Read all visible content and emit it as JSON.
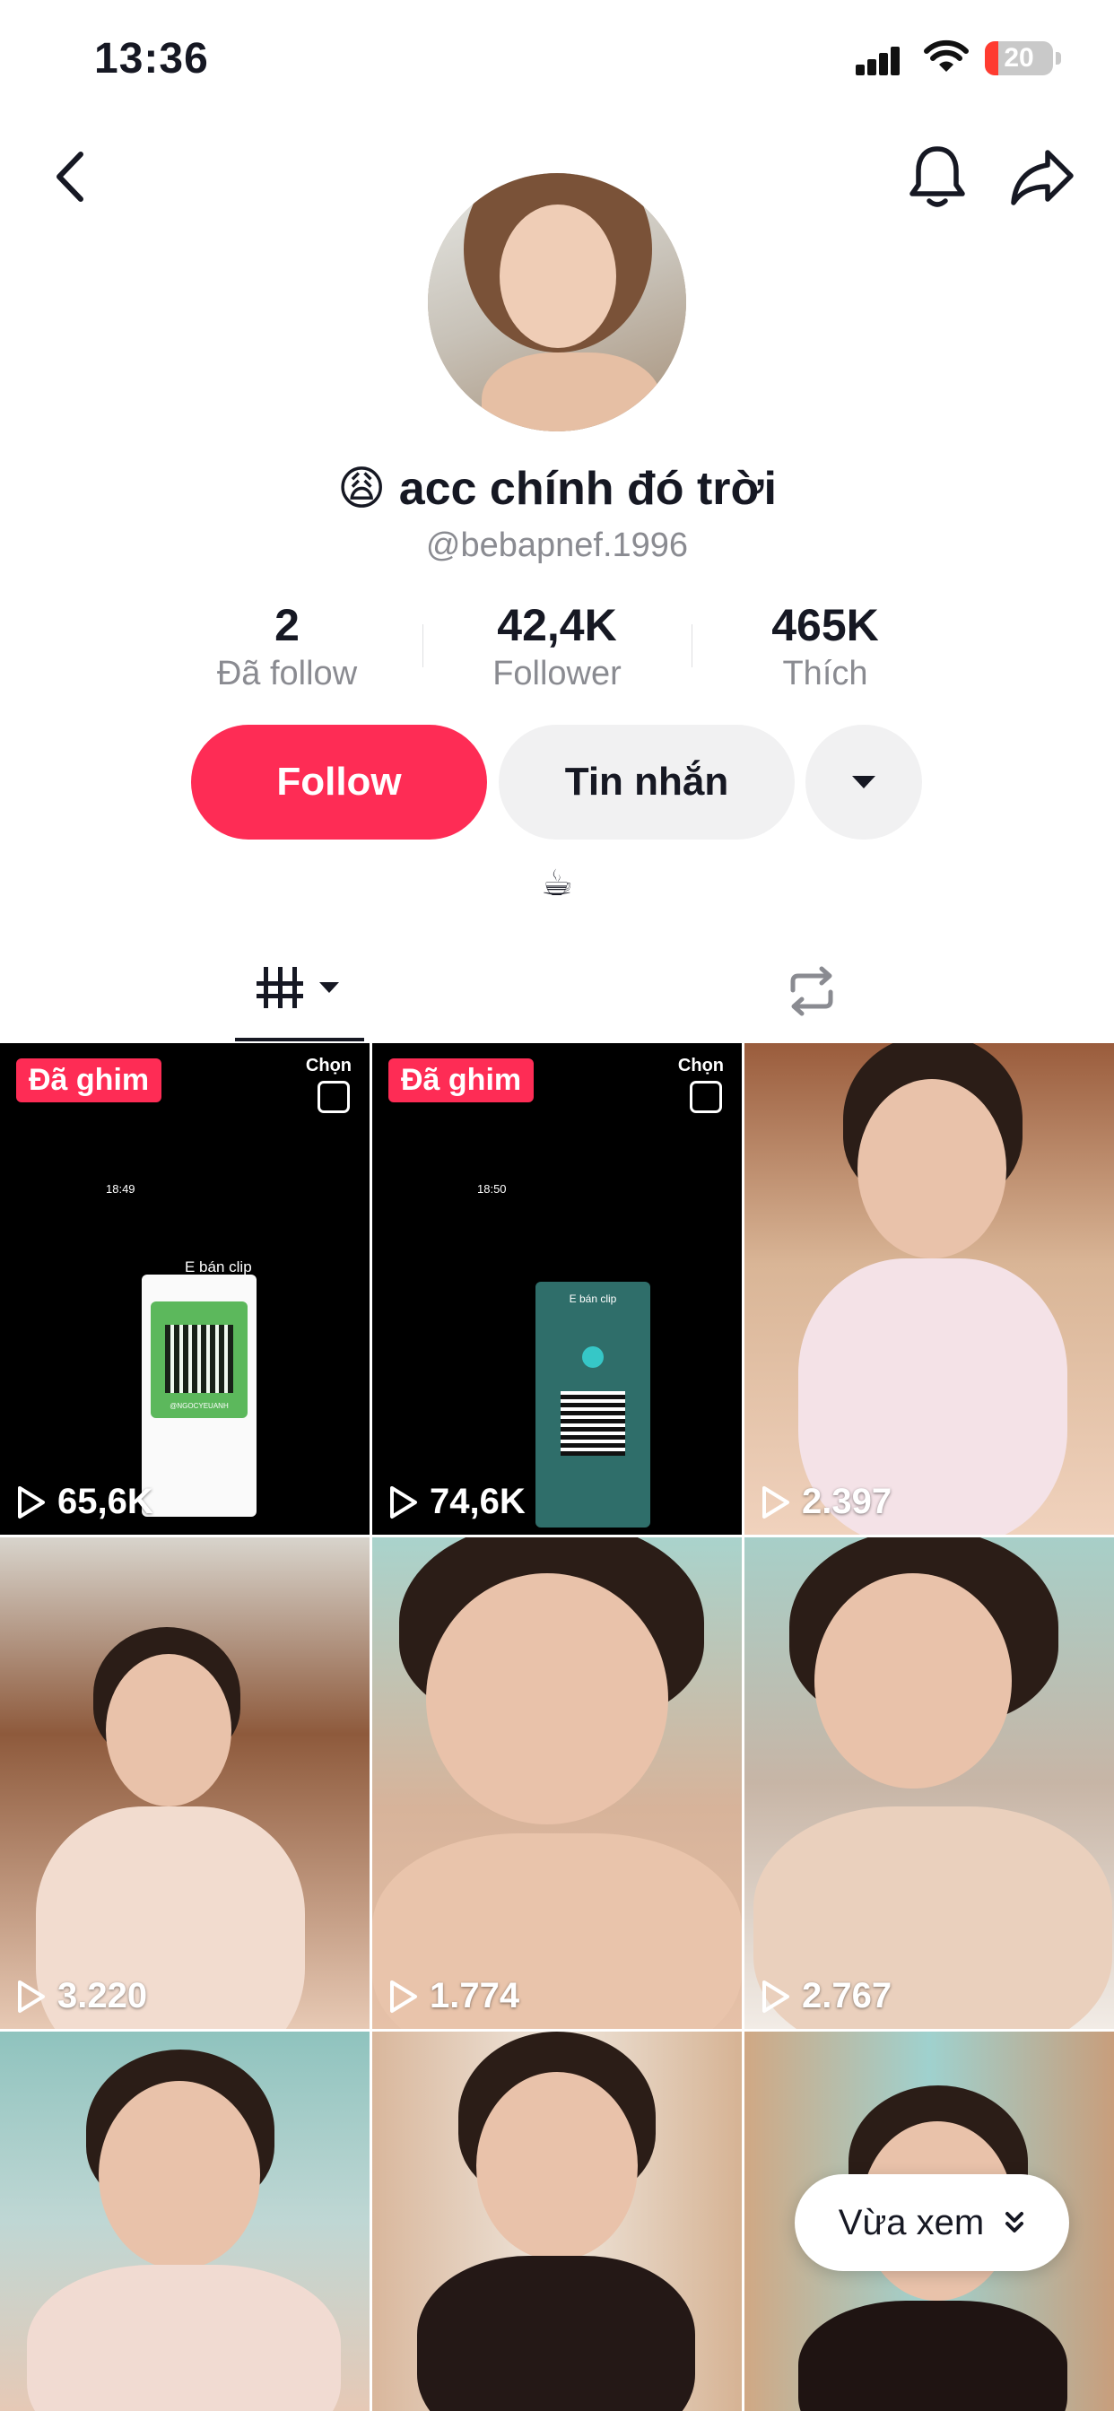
{
  "status_bar": {
    "time": "13:36",
    "battery": "20",
    "battery_fraction": 0.2
  },
  "profile": {
    "display_name": "😩 acc chính đó trời",
    "username": "@bebapnef.1996",
    "stats": [
      {
        "value": "2",
        "label": "Đã follow"
      },
      {
        "value": "42,4K",
        "label": "Follower"
      },
      {
        "value": "465K",
        "label": "Thích"
      }
    ],
    "follow_label": "Follow",
    "message_label": "Tin nhắn",
    "bio": "☕"
  },
  "colors": {
    "accent": "#fe2c55",
    "secondary_button": "#f1f1f2",
    "muted_text": "#8a8b91"
  },
  "videos": [
    {
      "views": "65,6K",
      "pinned_label": "Đã ghim",
      "select_label": "Chọn",
      "screen_time": "18:49",
      "screen_title": "E bán clip",
      "screen_user": "@NGOCYEUANH"
    },
    {
      "views": "74,6K",
      "pinned_label": "Đã ghim",
      "select_label": "Chọn",
      "screen_time": "18:50",
      "screen_title": "E bán clip"
    },
    {
      "views": "2.397"
    },
    {
      "views": "3.220"
    },
    {
      "views": "1.774"
    },
    {
      "views": "2.767"
    },
    {
      "views": ""
    },
    {
      "views": ""
    },
    {
      "views": ""
    }
  ],
  "floating_button": {
    "label": "Vừa xem"
  }
}
